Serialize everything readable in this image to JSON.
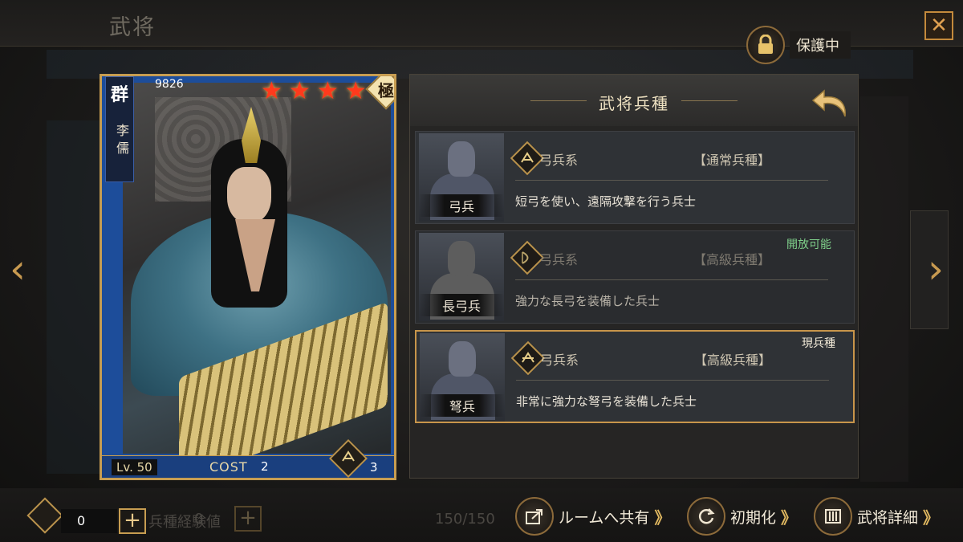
{
  "header": {
    "title": "武将",
    "close_label": "✕"
  },
  "protect": {
    "label": "保護中"
  },
  "nav": {
    "prev": "‹",
    "next": "›"
  },
  "card": {
    "faction": "群",
    "name": "李儒",
    "power": "9826",
    "stars": 4,
    "rarity": "極",
    "level": "Lv. 50",
    "cost_label": "COST",
    "cost_value": "2",
    "class_count": "3"
  },
  "panel": {
    "title": "武将兵種",
    "troops": [
      {
        "name": "弓兵",
        "type": "弓兵系",
        "grade": "【通常兵種】",
        "desc": "短弓を使い、遠隔攻撃を行う兵士",
        "status": ""
      },
      {
        "name": "長弓兵",
        "type": "弓兵系",
        "grade": "【高級兵種】",
        "desc": "強力な長弓を装備した兵士",
        "status": "開放可能"
      },
      {
        "name": "弩兵",
        "type": "弓兵系",
        "grade": "【高級兵種】",
        "desc": "非常に強力な弩弓を装備した兵士",
        "status": "現兵種"
      }
    ]
  },
  "bottom": {
    "resource_value": "0",
    "ghost_label": "兵種経験値",
    "ghost_value": "0",
    "capacity": "150/150",
    "plus": "+",
    "share_label": "ルームへ共有",
    "reset_label": "初期化",
    "detail_label": "武将詳細",
    "chevron": "》"
  },
  "colors": {
    "accent_gold": "#c79d51",
    "star_red": "#ff3a1c",
    "unlock_green": "#7fcf8a",
    "card_blue": "#1d4d9a"
  },
  "icons": {
    "lock": "lock-icon",
    "close": "close-icon",
    "back": "back-arrow-icon",
    "troop_type": "bow-icon",
    "share": "share-icon",
    "reset": "reset-icon",
    "detail": "scroll-icon"
  }
}
